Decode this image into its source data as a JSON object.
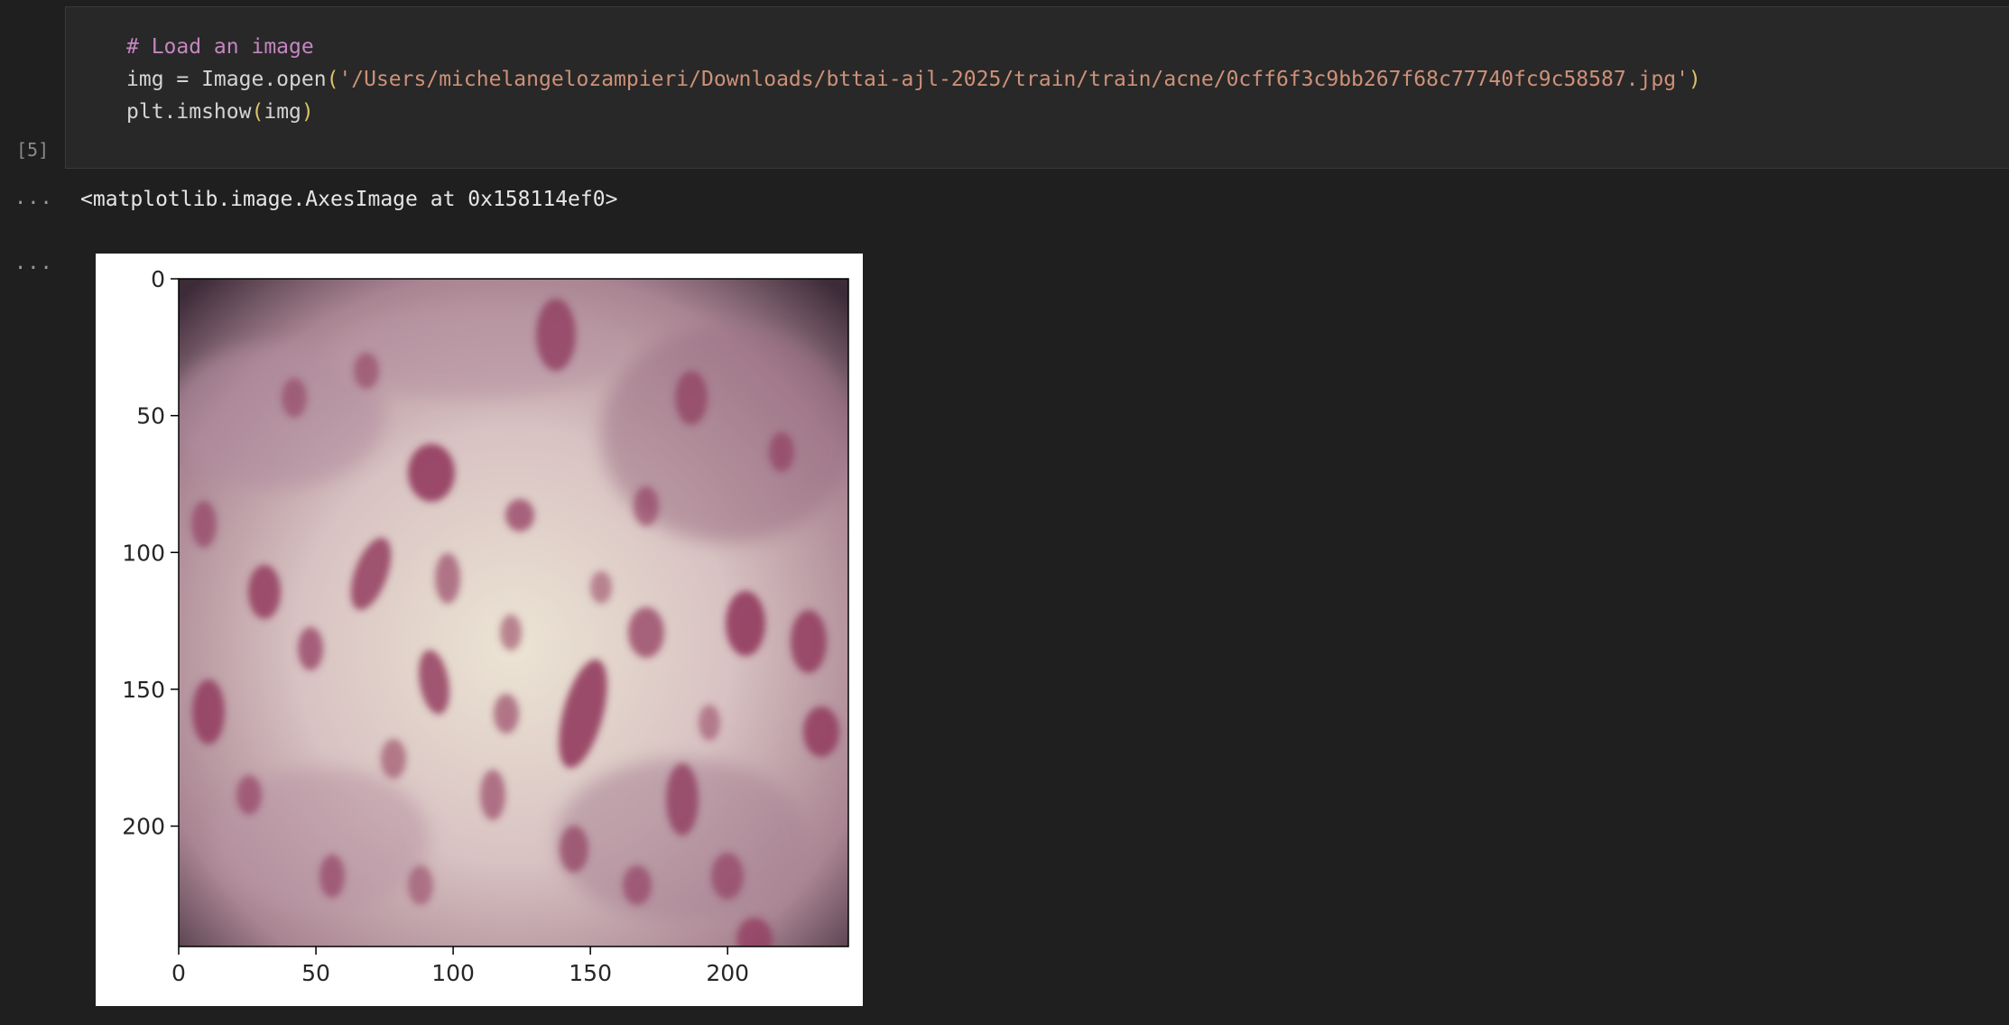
{
  "cell": {
    "execution_count": "[5]",
    "code": {
      "comment": "# Load an image",
      "line2_prefix": "img = Image.open",
      "line2_open": "(",
      "line2_string": "'/Users/michelangelozampieri/Downloads/bttai-ajl-2025/train/train/acne/0cff6f3c9bb267f68c77740fc9c58587.jpg'",
      "line2_close": ")",
      "line3_prefix": "plt.imshow",
      "line3_open": "(",
      "line3_arg": "img",
      "line3_close": ")"
    }
  },
  "output": {
    "more_icon_1": "...",
    "more_icon_2": "...",
    "repr_text": "<matplotlib.image.AxesImage at 0x158114ef0>"
  },
  "figure": {
    "type": "image",
    "content": "dermatology photo of skin with acne lesions",
    "colors": {
      "skin": "#d9bfc0",
      "lesion": "#8e3458",
      "shadow": "#3b2a35"
    }
  },
  "chart_data": {
    "type": "image",
    "xlim": [
      0,
      244
    ],
    "ylim": [
      244,
      0
    ],
    "x_ticks": [
      "0",
      "50",
      "100",
      "150",
      "200"
    ],
    "y_ticks": [
      "0",
      "50",
      "100",
      "150",
      "200"
    ],
    "x_tick_values": [
      0,
      50,
      100,
      150,
      200
    ],
    "y_tick_values": [
      0,
      50,
      100,
      150,
      200
    ]
  }
}
